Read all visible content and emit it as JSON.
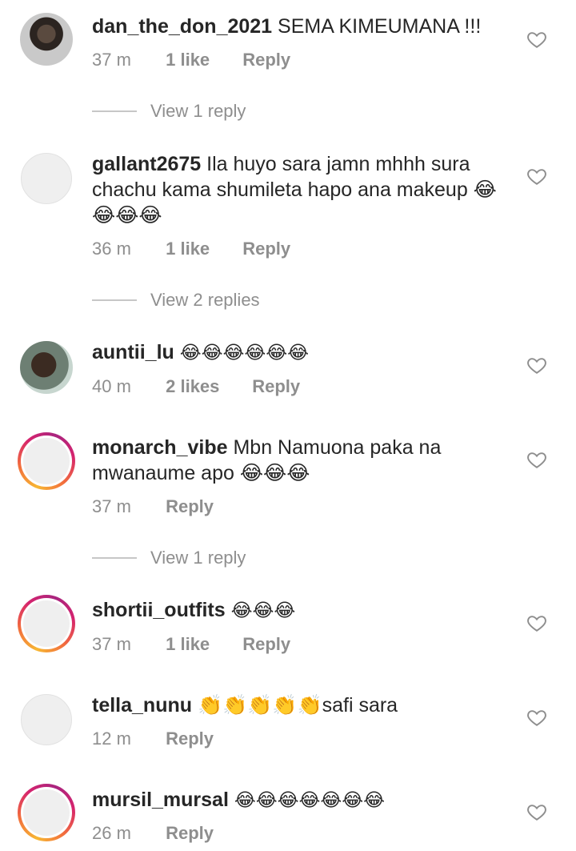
{
  "comments": [
    {
      "username": "dan_the_don_2021",
      "text": "SEMA KIMEUMANA !!!",
      "time": "37 m",
      "likes": "1 like",
      "reply": "Reply",
      "view_replies": "View 1 reply",
      "avatar": "photo"
    },
    {
      "username": "gallant2675",
      "text": "Ila huyo sara jamn mhhh sura chachu kama shumileta hapo ana makeup 😂😂😂😂",
      "time": "36 m",
      "likes": "1 like",
      "reply": "Reply",
      "view_replies": "View 2 replies",
      "avatar": "default"
    },
    {
      "username": "auntii_lu",
      "text": "😂😂😂😂😂😂",
      "time": "40 m",
      "likes": "2 likes",
      "reply": "Reply",
      "avatar": "photo"
    },
    {
      "username": "monarch_vibe",
      "text": "Mbn Namuona paka na mwanaume apo 😂😂😂",
      "time": "37 m",
      "likes": "",
      "reply": "Reply",
      "view_replies": "View 1 reply",
      "avatar": "story"
    },
    {
      "username": "shortii_outfits",
      "text": "😂😂😂",
      "time": "37 m",
      "likes": "1 like",
      "reply": "Reply",
      "avatar": "story"
    },
    {
      "username": "tella_nunu",
      "text": "👏👏👏👏👏safi sara",
      "time": "12 m",
      "likes": "",
      "reply": "Reply",
      "avatar": "default"
    },
    {
      "username": "mursil_mursal",
      "text": "😂😂😂😂😂😂😂",
      "time": "26 m",
      "likes": "",
      "reply": "Reply",
      "avatar": "story"
    }
  ],
  "icons": {
    "like": "heart-outline-icon"
  },
  "colors": {
    "primary_text": "#262626",
    "secondary_text": "#8e8e8e",
    "story_ring": "#d6246e"
  }
}
